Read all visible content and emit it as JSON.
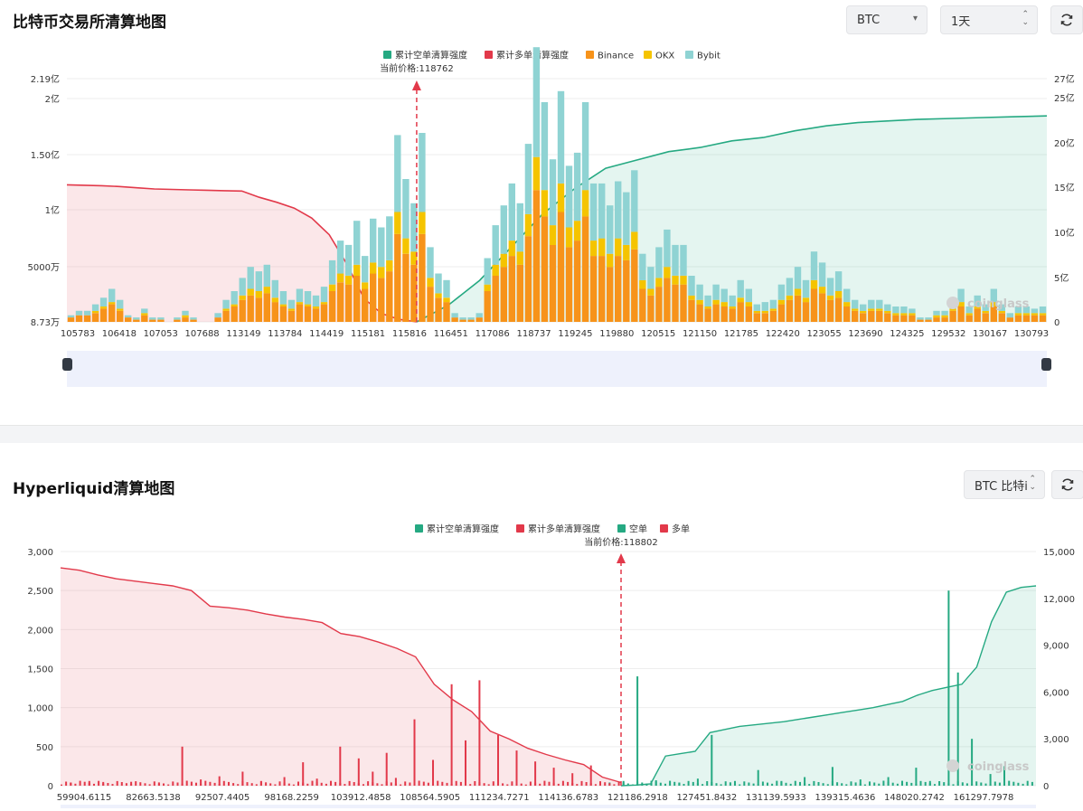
{
  "section1": {
    "title": "比特币交易所清算地图",
    "coin_select": "BTC",
    "range_select": "1天"
  },
  "section2": {
    "title": "Hyperliquid清算地图",
    "coin_select": "BTC  比特i"
  },
  "watermark": "coinglass",
  "colors": {
    "long_red": "#e2394a",
    "short_green": "#25a982",
    "binance": "#f7931a",
    "okx": "#f5c400",
    "bybit": "#8fd3d3",
    "slider_bg": "#eef1fc"
  },
  "chart_data": [
    {
      "type": "bar",
      "title": "",
      "price_label": "当前价格:118762",
      "current_price_index": 42,
      "legend": [
        "累计空单清算强度",
        "累计多单清算强度",
        "Binance",
        "OKX",
        "Bybit"
      ],
      "legend_placement": "top-center",
      "x_tick_labels": [
        "105783",
        "106418",
        "107053",
        "107688",
        "113149",
        "113784",
        "114419",
        "115181",
        "115816",
        "116451",
        "117086",
        "118737",
        "119245",
        "119880",
        "120515",
        "121150",
        "121785",
        "122420",
        "123055",
        "123690",
        "124325",
        "129532",
        "130167",
        "130793"
      ],
      "y_left_ticks": [
        "8.73万",
        "5000万",
        "1亿",
        "1.50亿",
        "2亿",
        "2.19亿"
      ],
      "y_left_range": [
        873000,
        219000000
      ],
      "y_right_ticks": [
        "0",
        "5亿",
        "10亿",
        "15亿",
        "20亿",
        "25亿",
        "27亿"
      ],
      "y_right_range": [
        0,
        2700000000
      ],
      "series": [
        {
          "name": "Binance",
          "values": [
            2,
            3,
            3,
            4,
            6,
            8,
            5,
            2,
            1,
            3,
            1,
            1,
            0,
            1,
            2,
            1,
            0,
            0,
            2,
            5,
            7,
            10,
            12,
            11,
            13,
            9,
            7,
            5,
            8,
            7,
            6,
            8,
            14,
            18,
            17,
            21,
            15,
            22,
            20,
            23,
            40,
            31,
            26,
            40,
            16,
            11,
            9,
            2,
            1,
            1,
            2,
            14,
            21,
            25,
            30,
            26,
            39,
            60,
            48,
            35,
            50,
            34,
            37,
            48,
            30,
            30,
            25,
            30,
            28,
            33,
            15,
            12,
            16,
            20,
            17,
            17,
            10,
            8,
            6,
            8,
            7,
            6,
            9,
            7,
            4,
            4,
            5,
            8,
            10,
            12,
            9,
            15,
            13,
            10,
            11,
            7,
            5,
            4,
            5,
            5,
            4,
            3,
            3,
            3,
            1,
            1,
            2,
            2,
            5,
            7,
            3,
            6,
            4,
            7,
            4,
            2,
            3,
            3,
            3,
            3
          ]
        },
        {
          "name": "OKX",
          "values": [
            0,
            0,
            0,
            1,
            1,
            1,
            1,
            0,
            0,
            1,
            0,
            0,
            0,
            0,
            1,
            0,
            0,
            0,
            0,
            1,
            1,
            2,
            3,
            3,
            3,
            2,
            1,
            1,
            1,
            1,
            1,
            1,
            3,
            4,
            4,
            5,
            3,
            5,
            5,
            5,
            10,
            7,
            6,
            10,
            4,
            2,
            2,
            0,
            0,
            0,
            0,
            3,
            5,
            6,
            7,
            6,
            10,
            15,
            12,
            9,
            13,
            9,
            9,
            12,
            7,
            8,
            6,
            8,
            7,
            8,
            4,
            3,
            4,
            5,
            4,
            4,
            2,
            2,
            1,
            2,
            2,
            1,
            2,
            2,
            1,
            1,
            1,
            2,
            2,
            3,
            2,
            4,
            3,
            2,
            3,
            2,
            1,
            1,
            1,
            1,
            1,
            1,
            1,
            1,
            0,
            0,
            1,
            1,
            1,
            2,
            1,
            1,
            1,
            2,
            1,
            0,
            1,
            1,
            1,
            1
          ]
        },
        {
          "name": "Bybit",
          "values": [
            1,
            2,
            2,
            3,
            4,
            6,
            4,
            1,
            1,
            2,
            1,
            1,
            0,
            1,
            2,
            1,
            0,
            0,
            2,
            4,
            6,
            8,
            10,
            9,
            10,
            8,
            6,
            4,
            6,
            6,
            5,
            7,
            11,
            15,
            14,
            20,
            12,
            20,
            18,
            20,
            35,
            27,
            22,
            36,
            14,
            9,
            8,
            2,
            1,
            1,
            2,
            12,
            18,
            22,
            26,
            22,
            32,
            50,
            40,
            30,
            42,
            28,
            31,
            40,
            26,
            25,
            22,
            26,
            24,
            28,
            12,
            10,
            14,
            17,
            14,
            14,
            9,
            7,
            5,
            7,
            6,
            5,
            8,
            6,
            3,
            4,
            4,
            7,
            8,
            10,
            8,
            13,
            11,
            8,
            9,
            6,
            4,
            3,
            4,
            4,
            3,
            3,
            3,
            2,
            1,
            1,
            2,
            2,
            4,
            6,
            3,
            5,
            3,
            6,
            3,
            2,
            3,
            3,
            2,
            3
          ]
        }
      ],
      "bar_scale_max": 100,
      "cum_long_curve": [
        1.65,
        1.645,
        1.64,
        1.63,
        1.615,
        1.6,
        1.595,
        1.59,
        1.585,
        1.58,
        1.575,
        1.5,
        1.44,
        1.37,
        1.25,
        1.05,
        0.7,
        0.28,
        0.1,
        0.03,
        0
      ],
      "cum_short_curve": [
        0,
        0.2,
        0.5,
        0.9,
        1.3,
        1.6,
        1.85,
        1.95,
        2.05,
        2.1,
        2.18,
        2.22,
        2.3,
        2.36,
        2.4,
        2.42,
        2.44,
        2.45,
        2.46,
        2.47,
        2.48
      ]
    },
    {
      "type": "bar",
      "title": "",
      "price_label": "当前价格:118802",
      "legend": [
        "累计空单清算强度",
        "累计多单清算强度",
        "空单",
        "多单"
      ],
      "legend_placement": "top-center",
      "x_tick_labels": [
        "59904.6115",
        "82663.5138",
        "92507.4405",
        "98168.2259",
        "103912.4858",
        "108564.5905",
        "111234.7271",
        "114136.6783",
        "121186.2918",
        "127451.8432",
        "131139.5933",
        "139315.4636",
        "148020.2742",
        "161297.7978"
      ],
      "y_left_ticks": [
        "0",
        "500",
        "1,000",
        "1,500",
        "2,000",
        "2,500",
        "3,000"
      ],
      "y_left_range": [
        0,
        3000
      ],
      "y_right_ticks": [
        "0",
        "3,000",
        "6,000",
        "9,000",
        "12,000",
        "15,000"
      ],
      "y_right_range": [
        0,
        15000
      ],
      "long_bars": [
        [
          2,
          40
        ],
        [
          6,
          60
        ],
        [
          9,
          30
        ],
        [
          15,
          50
        ],
        [
          21,
          25
        ],
        [
          26,
          500
        ],
        [
          30,
          80
        ],
        [
          34,
          120
        ],
        [
          39,
          180
        ],
        [
          43,
          60
        ],
        [
          48,
          110
        ],
        [
          52,
          300
        ],
        [
          55,
          90
        ],
        [
          60,
          500
        ],
        [
          64,
          350
        ],
        [
          67,
          180
        ],
        [
          70,
          420
        ],
        [
          72,
          100
        ],
        [
          76,
          850
        ],
        [
          80,
          330
        ],
        [
          84,
          1300
        ],
        [
          87,
          580
        ],
        [
          90,
          1350
        ],
        [
          94,
          650
        ],
        [
          98,
          450
        ],
        [
          102,
          310
        ],
        [
          106,
          230
        ],
        [
          110,
          160
        ],
        [
          114,
          260
        ]
      ],
      "short_bars": [
        [
          118,
          40
        ],
        [
          121,
          60
        ],
        [
          124,
          1400
        ],
        [
          128,
          70
        ],
        [
          133,
          40
        ],
        [
          137,
          90
        ],
        [
          140,
          650
        ],
        [
          145,
          60
        ],
        [
          150,
          200
        ],
        [
          155,
          60
        ],
        [
          160,
          110
        ],
        [
          166,
          240
        ],
        [
          172,
          80
        ],
        [
          178,
          110
        ],
        [
          184,
          230
        ],
        [
          187,
          60
        ],
        [
          191,
          2500
        ],
        [
          193,
          1450
        ],
        [
          196,
          600
        ],
        [
          200,
          150
        ],
        [
          203,
          250
        ]
      ],
      "cum_long_curve": [
        2790,
        2760,
        2700,
        2650,
        2620,
        2590,
        2560,
        2500,
        2300,
        2280,
        2250,
        2200,
        2160,
        2130,
        2090,
        1950,
        1910,
        1840,
        1760,
        1650,
        1300,
        1100,
        950,
        700,
        600,
        480,
        400,
        330,
        270,
        110,
        40
      ],
      "cum_short_curve": [
        0,
        40,
        120,
        1900,
        2050,
        2200,
        3400,
        3600,
        3800,
        3900,
        4000,
        4100,
        4250,
        4400,
        4550,
        4700,
        4850,
        5000,
        5200,
        5400,
        5800,
        6100,
        6300,
        6500,
        7600,
        10500,
        12400,
        12700,
        12800
      ]
    }
  ]
}
